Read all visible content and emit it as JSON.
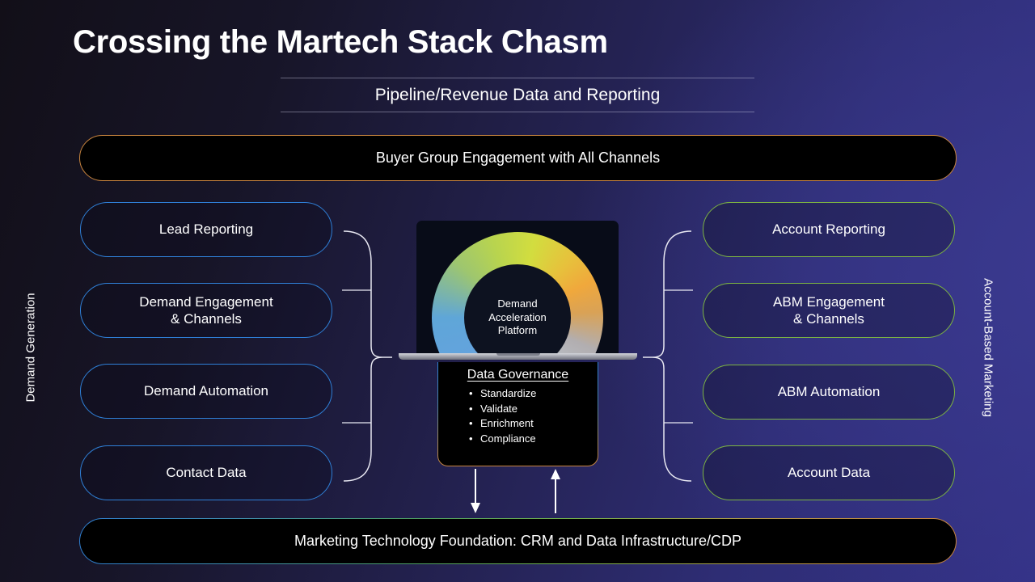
{
  "header": {
    "title": "Crossing the Martech Stack Chasm",
    "subtitle": "Pipeline/Revenue Data and Reporting"
  },
  "banners": {
    "top": "Buyer Group Engagement with All Channels",
    "bottom": "Marketing Technology Foundation: CRM and Data Infrastructure/CDP"
  },
  "side_labels": {
    "left": "Demand Generation",
    "right": "Account-Based Marketing"
  },
  "left_column": {
    "accent_color": "#2f80d8",
    "items": [
      {
        "label": "Lead Reporting"
      },
      {
        "label": "Demand Engagement\n& Channels"
      },
      {
        "label": "Demand Automation"
      },
      {
        "label": "Contact Data"
      }
    ]
  },
  "right_column": {
    "accent_color": "#7cb342",
    "items": [
      {
        "label": "Account Reporting"
      },
      {
        "label": "ABM Engagement\n& Channels"
      },
      {
        "label": "ABM Automation"
      },
      {
        "label": "Account Data"
      }
    ]
  },
  "center": {
    "platform_name": "Demand\nAcceleration\nPlatform",
    "governance": {
      "title": "Data Governance",
      "items": [
        "Standardize",
        "Validate",
        "Enrichment",
        "Compliance"
      ]
    }
  },
  "colors": {
    "banner_top_border": "#c9853e",
    "background_dark": "#120f18",
    "background_purple": "#343287"
  }
}
